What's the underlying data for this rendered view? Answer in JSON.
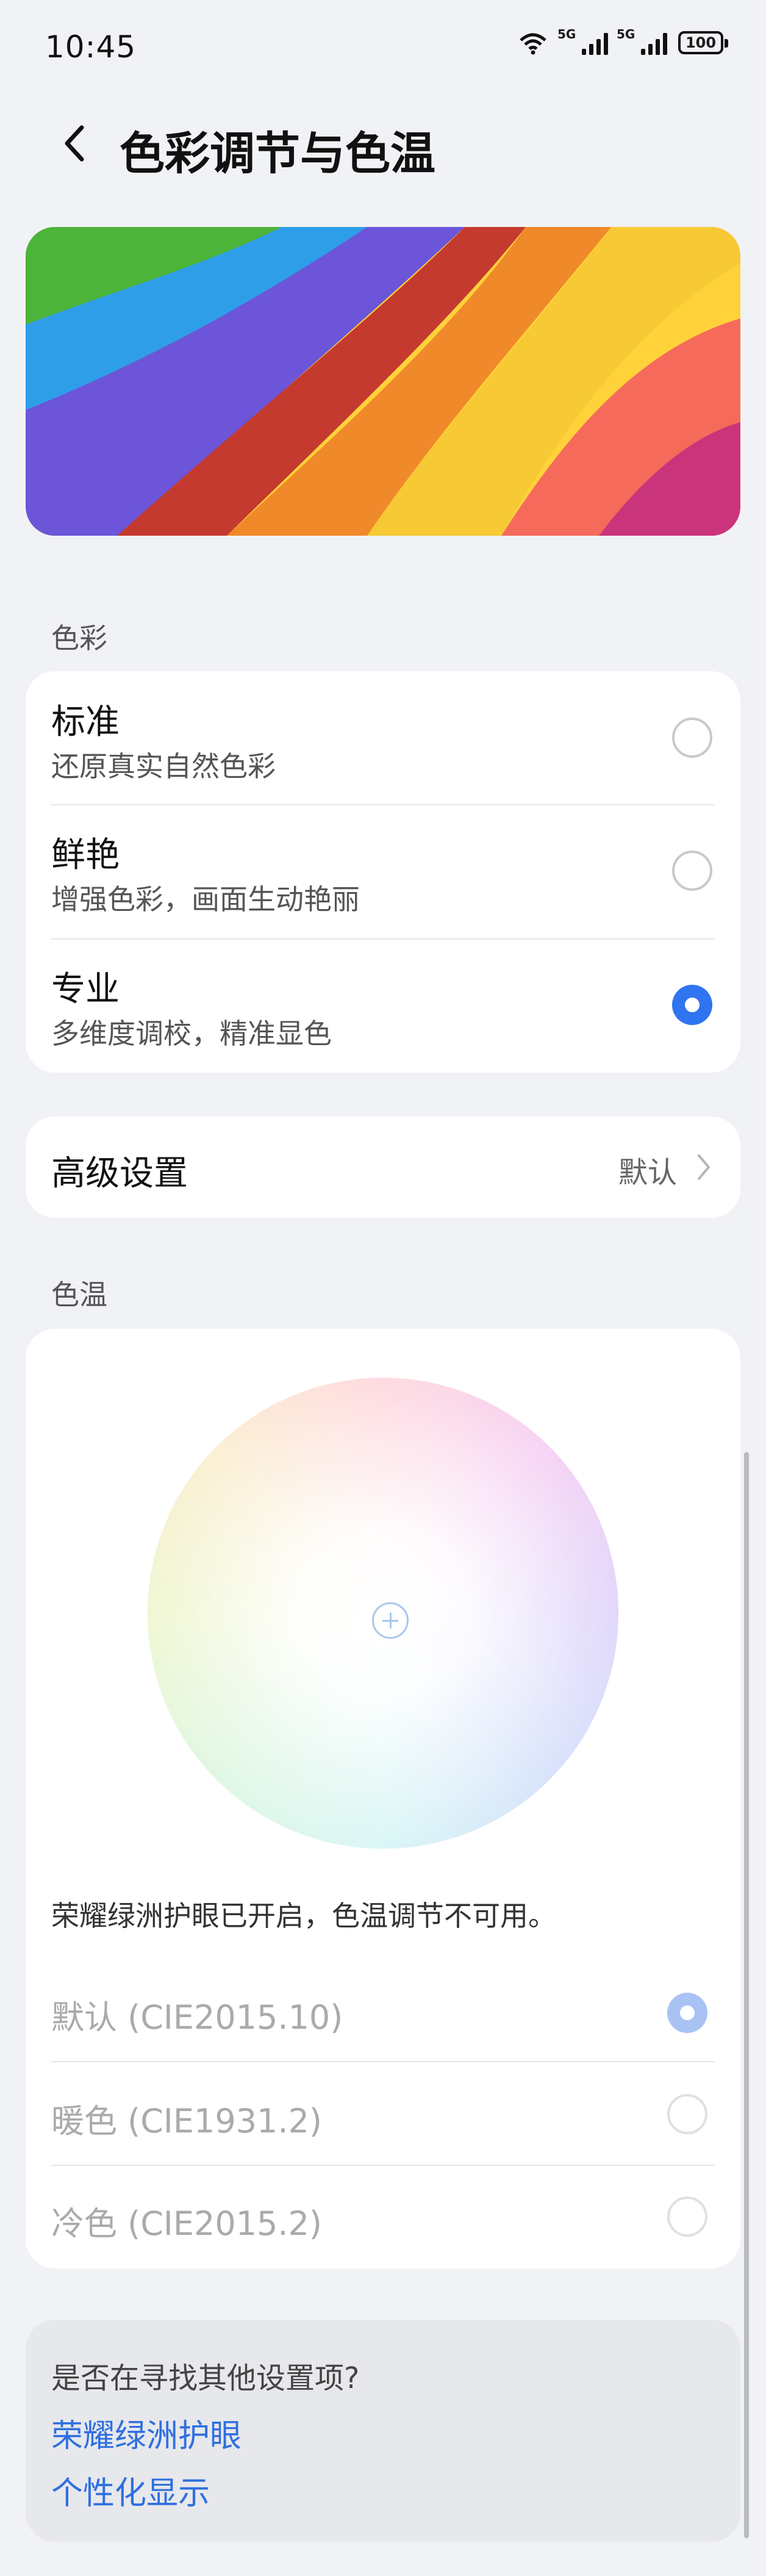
{
  "status_bar": {
    "time": "10:45",
    "wifi_label": "7",
    "sim1_label": "5G",
    "sim2_label": "5G",
    "battery": "100"
  },
  "header": {
    "title": "色彩调节与色温",
    "back_icon": "chevron-left-icon"
  },
  "color_section": {
    "label": "色彩",
    "options": [
      {
        "title": "标准",
        "subtitle": "还原真实自然色彩",
        "selected": false
      },
      {
        "title": "鲜艳",
        "subtitle": "增强色彩，画面生动艳丽",
        "selected": false
      },
      {
        "title": "专业",
        "subtitle": "多维度调校，精准显色",
        "selected": true
      }
    ]
  },
  "advanced": {
    "title": "高级设置",
    "value": "默认"
  },
  "temperature_section": {
    "label": "色温",
    "notice": "荣耀绿洲护眼已开启，色温调节不可用。",
    "options": [
      {
        "title": "默认 (CIE2015.10)",
        "selected": true
      },
      {
        "title": "暖色 (CIE1931.2)",
        "selected": false
      },
      {
        "title": "冷色 (CIE2015.2)",
        "selected": false
      }
    ]
  },
  "search_suggestions": {
    "question": "是否在寻找其他设置项?",
    "links": [
      "荣耀绿洲护眼",
      "个性化显示"
    ]
  },
  "colors": {
    "accent": "#2f74f0",
    "link": "#2f6fe0",
    "background": "#f1f2f6"
  }
}
